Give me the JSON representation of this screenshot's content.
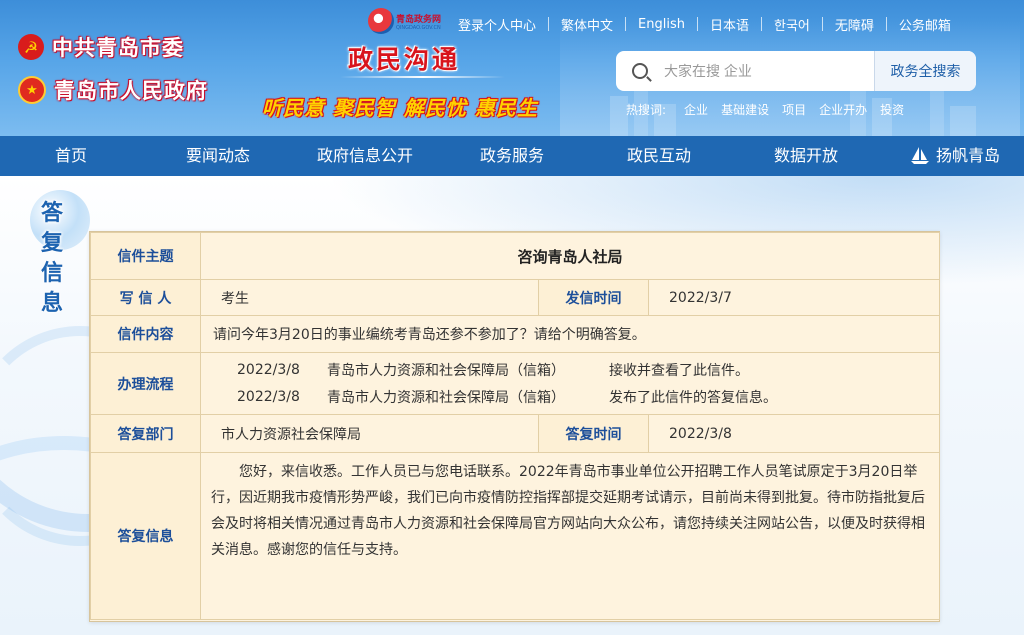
{
  "header": {
    "party_name": "中共青岛市委",
    "gov_name": "青岛市人民政府",
    "site_logo_text": "青岛政务网",
    "site_logo_sub": "QINGDAO.GOV.CN",
    "brand_title": "政民沟通",
    "slogan": "听民意 聚民智 解民忧 惠民生",
    "top_links": [
      "登录个人中心",
      "繁体中文",
      "English",
      "日本语",
      "한국어",
      "无障碍",
      "公务邮箱"
    ],
    "search": {
      "placeholder": "大家在搜 企业",
      "button": "政务全搜索"
    },
    "hot_label": "热搜词:",
    "hot_words": [
      "企业",
      "基础建设",
      "项目",
      "企业开办",
      "投资"
    ]
  },
  "nav": {
    "items": [
      "首页",
      "要闻动态",
      "政府信息公开",
      "政务服务",
      "政民互动",
      "数据开放",
      "扬帆青岛"
    ]
  },
  "side_title": "答复信息",
  "letter": {
    "subject_label": "信件主题",
    "subject": "咨询青岛人社局",
    "writer_label": "写 信 人",
    "writer": "考生",
    "sent_label": "发信时间",
    "sent_time": "2022/3/7",
    "content_label": "信件内容",
    "content": "请问今年3月20日的事业编统考青岛还参不参加了？请给个明确答复。",
    "process_label": "办理流程",
    "process": [
      {
        "date": "2022/3/8",
        "dept": "青岛市人力资源和社会保障局（信箱）",
        "action": "接收并查看了此信件。"
      },
      {
        "date": "2022/3/8",
        "dept": "青岛市人力资源和社会保障局（信箱）",
        "action": "发布了此信件的答复信息。"
      }
    ],
    "reply_dept_label": "答复部门",
    "reply_dept": "市人力资源社会保障局",
    "reply_time_label": "答复时间",
    "reply_time": "2022/3/8",
    "reply_label": "答复信息",
    "reply": "您好，来信收悉。工作人员已与您电话联系。2022年青岛市事业单位公开招聘工作人员笔试原定于3月20日举行，因近期我市疫情形势严峻，我们已向市疫情防控指挥部提交延期考试请示，目前尚未得到批复。待市防指批复后会及时将相关情况通过青岛市人力资源和社会保障局官方网站向大众公布，请您持续关注网站公告，以便及时获得相关消息。感谢您的信任与支持。"
  }
}
